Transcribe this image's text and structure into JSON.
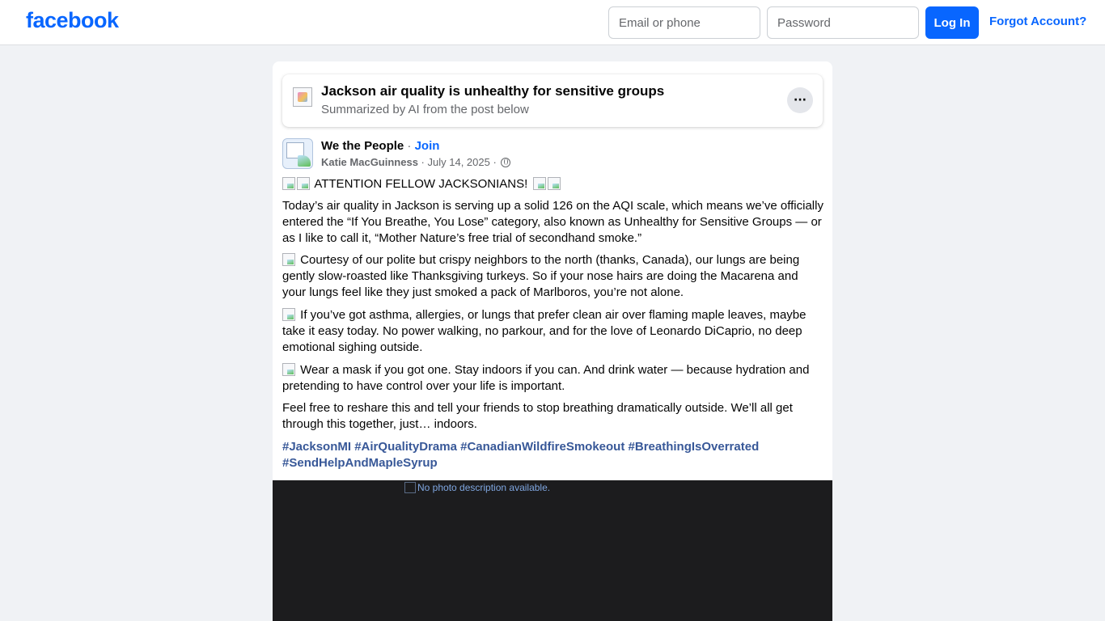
{
  "header": {
    "logo": "facebook",
    "email_placeholder": "Email or phone",
    "password_placeholder": "Password",
    "login_label": "Log In",
    "forgot_label": "Forgot Account?",
    "brand_color": "#0866ff"
  },
  "ai_summary": {
    "title": "Jackson air quality is unhealthy for sensitive groups",
    "subtitle": "Summarized by AI from the post below",
    "more_label": "···"
  },
  "post": {
    "group_name": "We the People",
    "separator": " · ",
    "join_label": "Join",
    "author": "Katie MacGuinness",
    "date": "July 14, 2025",
    "privacy_icon": "globe-icon",
    "headline": "ATTENTION FELLOW JACKSONIANS!",
    "paragraphs": [
      "Today’s air quality in Jackson is serving up a solid 126 on the AQI scale, which means we’ve officially entered the “If You Breathe, You Lose” category, also known as Unhealthy for Sensitive Groups — or as I like to call it, “Mother Nature’s free trial of secondhand smoke.”",
      "Courtesy of our polite but crispy neighbors to the north (thanks, Canada), our lungs are being gently slow-roasted like Thanksgiving turkeys. So if your nose hairs are doing the Macarena and your lungs feel like they just smoked a pack of Marlboros, you’re not alone.",
      "If you’ve got asthma, allergies, or lungs that prefer clean air over flaming maple leaves, maybe take it easy today. No power walking, no parkour, and for the love of Leonardo DiCaprio, no deep emotional sighing outside.",
      "Wear a mask if you got one. Stay indoors if you can. And drink water — because hydration and pretending to have control over your life is important.",
      "Feel free to reshare this and tell your friends to stop breathing dramatically outside. We’ll all get through this together, just… indoors."
    ],
    "hashtags": [
      "#JacksonMI",
      "#AirQualityDrama",
      "#CanadianWildfireSmokeout",
      "#BreathingIsOverrated",
      "#SendHelpAndMapleSyrup"
    ],
    "photo_alt": "No photo description available."
  }
}
